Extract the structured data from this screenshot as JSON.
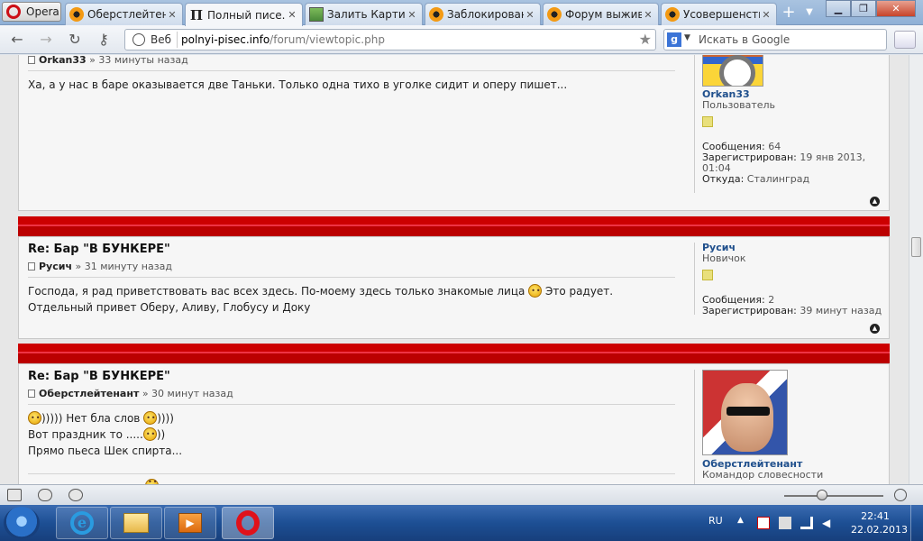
{
  "browser": {
    "menu_label": "Opera",
    "tabs": [
      {
        "label": "Оберстлейтен...",
        "favicon": "orange-circle-icon"
      },
      {
        "label": "Полный писе...",
        "favicon": "p-letter-icon",
        "active": true
      },
      {
        "label": "Залить Картин...",
        "favicon": "image-icon"
      },
      {
        "label": "Заблокирован...",
        "favicon": "orange-circle-icon"
      },
      {
        "label": "Форум выжив...",
        "favicon": "orange-circle-icon"
      },
      {
        "label": "Усовершенств...",
        "favicon": "orange-circle-icon"
      }
    ],
    "web_label": "Веб",
    "url_domain": "polnyi-pisec.info",
    "url_path": "/forum/viewtopic.php",
    "search_placeholder": "Искать в Google"
  },
  "posts": [
    {
      "author": "Orkan33",
      "time": "» 33 минуты назад",
      "lines": [
        "Ха, а у нас в баре оказывается две Таньки. Только одна тихо в уголке сидит и оперу пишет..."
      ],
      "profile": {
        "name": "Orkan33",
        "rank": "Пользователь",
        "messages_label": "Сообщения:",
        "messages": "64",
        "registered_label": "Зарегистрирован:",
        "registered": "19 янв 2013, 01:04",
        "from_label": "Откуда:",
        "from": "Сталинград"
      }
    },
    {
      "title": "Re: Бар \"В БУНКЕРЕ\"",
      "author": "Русич",
      "time": "» 31 минуту назад",
      "line1_a": "Господа, я рад приветствовать вас всех здесь. По-моему здесь только знакомые лица",
      "line1_b": "Это радует.",
      "line2": "Отдельный привет Оберу, Аливу, Глобусу и Доку",
      "profile": {
        "name": "Русич",
        "rank": "Новичок",
        "messages_label": "Сообщения:",
        "messages": "2",
        "registered_label": "Зарегистрирован:",
        "registered": "39 минут назад"
      }
    },
    {
      "title": "Re: Бар \"В БУНКЕРЕ\"",
      "author": "Оберстлейтенант",
      "time": "» 30 минут назад",
      "line1_a": "))))) Нет бла слов",
      "line1_b": "))))",
      "line2_a": "Вот праздник то .....",
      "line2_b": "))",
      "line3": "Прямо пьеса Шек спирта...",
      "profile": {
        "name": "Оберстлейтенант",
        "rank": "Командор словесности"
      }
    }
  ],
  "taskbar": {
    "lang": "RU",
    "time": "22:41",
    "date": "22.02.2013"
  }
}
